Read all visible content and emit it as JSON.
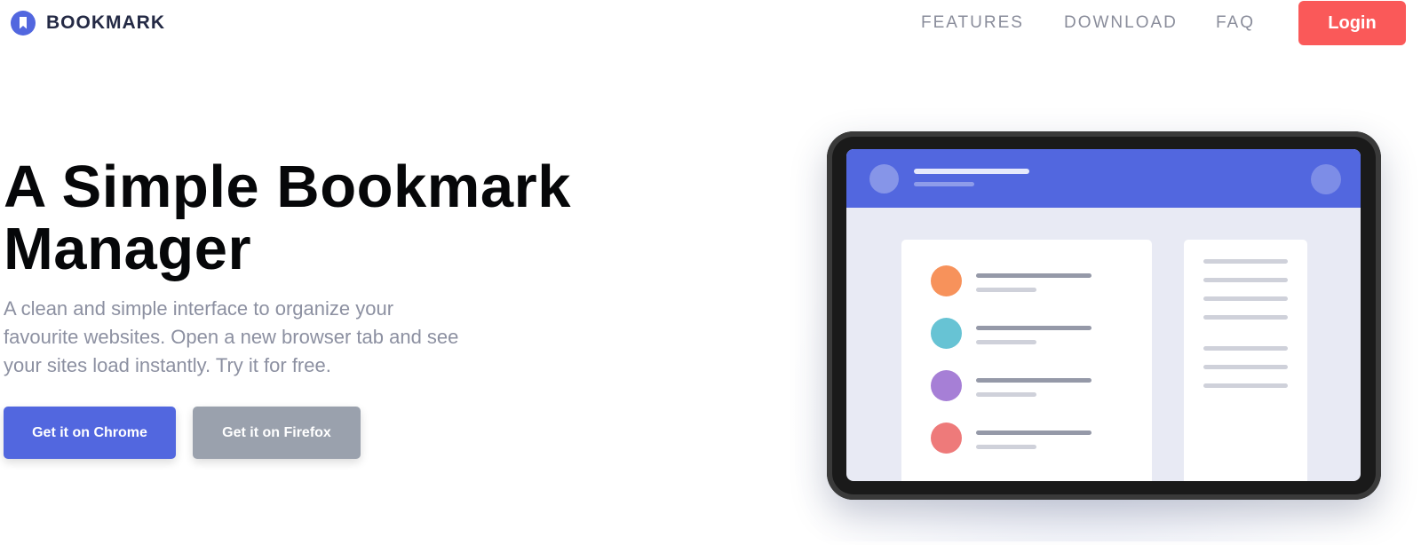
{
  "header": {
    "brand": "BOOKMARK",
    "nav": [
      "FEATURES",
      "DOWNLOAD",
      "FAQ"
    ],
    "login_label": "Login"
  },
  "hero": {
    "title": "A Simple Bookmark Manager",
    "subtitle": "A clean and simple interface to organize your favourite websites. Open a new browser tab and see your sites load instantly. Try it for free.",
    "chrome_label": "Get it on Chrome",
    "firefox_label": "Get it on Firefox"
  },
  "colors": {
    "primary": "#5267DF",
    "accent": "#FA5959",
    "secondary_button": "#9AA1AD",
    "heading": "#060709",
    "muted_text": "#8C90A1"
  },
  "illustration": {
    "list_dot_colors": [
      "#F7925B",
      "#67C3D4",
      "#A67FD6",
      "#EE7A7A"
    ]
  }
}
